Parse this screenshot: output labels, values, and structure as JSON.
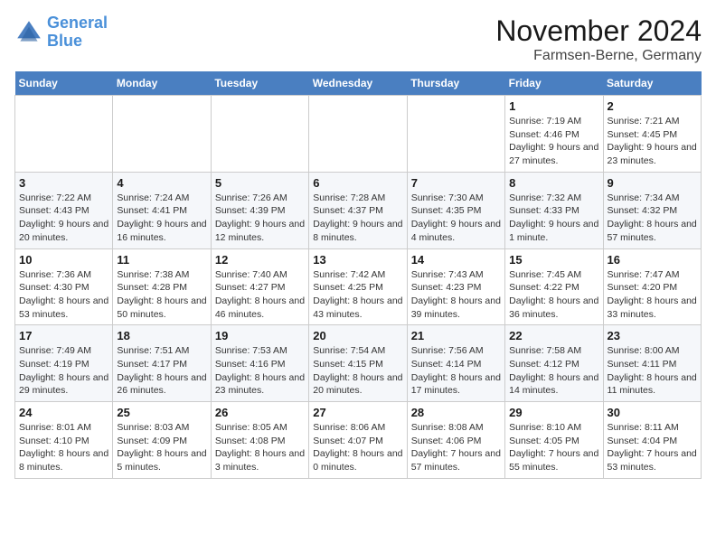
{
  "logo": {
    "line1": "General",
    "line2": "Blue"
  },
  "title": "November 2024",
  "location": "Farmsen-Berne, Germany",
  "days_of_week": [
    "Sunday",
    "Monday",
    "Tuesday",
    "Wednesday",
    "Thursday",
    "Friday",
    "Saturday"
  ],
  "weeks": [
    [
      {
        "day": "",
        "info": ""
      },
      {
        "day": "",
        "info": ""
      },
      {
        "day": "",
        "info": ""
      },
      {
        "day": "",
        "info": ""
      },
      {
        "day": "",
        "info": ""
      },
      {
        "day": "1",
        "info": "Sunrise: 7:19 AM\nSunset: 4:46 PM\nDaylight: 9 hours and 27 minutes."
      },
      {
        "day": "2",
        "info": "Sunrise: 7:21 AM\nSunset: 4:45 PM\nDaylight: 9 hours and 23 minutes."
      }
    ],
    [
      {
        "day": "3",
        "info": "Sunrise: 7:22 AM\nSunset: 4:43 PM\nDaylight: 9 hours and 20 minutes."
      },
      {
        "day": "4",
        "info": "Sunrise: 7:24 AM\nSunset: 4:41 PM\nDaylight: 9 hours and 16 minutes."
      },
      {
        "day": "5",
        "info": "Sunrise: 7:26 AM\nSunset: 4:39 PM\nDaylight: 9 hours and 12 minutes."
      },
      {
        "day": "6",
        "info": "Sunrise: 7:28 AM\nSunset: 4:37 PM\nDaylight: 9 hours and 8 minutes."
      },
      {
        "day": "7",
        "info": "Sunrise: 7:30 AM\nSunset: 4:35 PM\nDaylight: 9 hours and 4 minutes."
      },
      {
        "day": "8",
        "info": "Sunrise: 7:32 AM\nSunset: 4:33 PM\nDaylight: 9 hours and 1 minute."
      },
      {
        "day": "9",
        "info": "Sunrise: 7:34 AM\nSunset: 4:32 PM\nDaylight: 8 hours and 57 minutes."
      }
    ],
    [
      {
        "day": "10",
        "info": "Sunrise: 7:36 AM\nSunset: 4:30 PM\nDaylight: 8 hours and 53 minutes."
      },
      {
        "day": "11",
        "info": "Sunrise: 7:38 AM\nSunset: 4:28 PM\nDaylight: 8 hours and 50 minutes."
      },
      {
        "day": "12",
        "info": "Sunrise: 7:40 AM\nSunset: 4:27 PM\nDaylight: 8 hours and 46 minutes."
      },
      {
        "day": "13",
        "info": "Sunrise: 7:42 AM\nSunset: 4:25 PM\nDaylight: 8 hours and 43 minutes."
      },
      {
        "day": "14",
        "info": "Sunrise: 7:43 AM\nSunset: 4:23 PM\nDaylight: 8 hours and 39 minutes."
      },
      {
        "day": "15",
        "info": "Sunrise: 7:45 AM\nSunset: 4:22 PM\nDaylight: 8 hours and 36 minutes."
      },
      {
        "day": "16",
        "info": "Sunrise: 7:47 AM\nSunset: 4:20 PM\nDaylight: 8 hours and 33 minutes."
      }
    ],
    [
      {
        "day": "17",
        "info": "Sunrise: 7:49 AM\nSunset: 4:19 PM\nDaylight: 8 hours and 29 minutes."
      },
      {
        "day": "18",
        "info": "Sunrise: 7:51 AM\nSunset: 4:17 PM\nDaylight: 8 hours and 26 minutes."
      },
      {
        "day": "19",
        "info": "Sunrise: 7:53 AM\nSunset: 4:16 PM\nDaylight: 8 hours and 23 minutes."
      },
      {
        "day": "20",
        "info": "Sunrise: 7:54 AM\nSunset: 4:15 PM\nDaylight: 8 hours and 20 minutes."
      },
      {
        "day": "21",
        "info": "Sunrise: 7:56 AM\nSunset: 4:14 PM\nDaylight: 8 hours and 17 minutes."
      },
      {
        "day": "22",
        "info": "Sunrise: 7:58 AM\nSunset: 4:12 PM\nDaylight: 8 hours and 14 minutes."
      },
      {
        "day": "23",
        "info": "Sunrise: 8:00 AM\nSunset: 4:11 PM\nDaylight: 8 hours and 11 minutes."
      }
    ],
    [
      {
        "day": "24",
        "info": "Sunrise: 8:01 AM\nSunset: 4:10 PM\nDaylight: 8 hours and 8 minutes."
      },
      {
        "day": "25",
        "info": "Sunrise: 8:03 AM\nSunset: 4:09 PM\nDaylight: 8 hours and 5 minutes."
      },
      {
        "day": "26",
        "info": "Sunrise: 8:05 AM\nSunset: 4:08 PM\nDaylight: 8 hours and 3 minutes."
      },
      {
        "day": "27",
        "info": "Sunrise: 8:06 AM\nSunset: 4:07 PM\nDaylight: 8 hours and 0 minutes."
      },
      {
        "day": "28",
        "info": "Sunrise: 8:08 AM\nSunset: 4:06 PM\nDaylight: 7 hours and 57 minutes."
      },
      {
        "day": "29",
        "info": "Sunrise: 8:10 AM\nSunset: 4:05 PM\nDaylight: 7 hours and 55 minutes."
      },
      {
        "day": "30",
        "info": "Sunrise: 8:11 AM\nSunset: 4:04 PM\nDaylight: 7 hours and 53 minutes."
      }
    ]
  ]
}
